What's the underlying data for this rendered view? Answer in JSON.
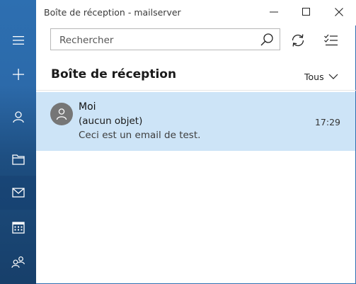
{
  "window": {
    "title": "Boîte de réception - mailserver"
  },
  "search": {
    "placeholder": "Rechercher"
  },
  "folder": {
    "title": "Boîte de réception",
    "filter_label": "Tous"
  },
  "messages": [
    {
      "sender": "Moi",
      "subject": "(aucun objet)",
      "preview": "Ceci est un email de test.",
      "time": "17:29",
      "selected": true
    }
  ],
  "nav": {
    "items": [
      "hamburger-icon",
      "new-mail-icon",
      "account-icon",
      "folder-icon",
      "mail-icon",
      "calendar-icon",
      "people-icon"
    ]
  },
  "colors": {
    "rail": "#2c6aaa",
    "selected_item": "#cde4f7",
    "avatar": "#767676"
  }
}
